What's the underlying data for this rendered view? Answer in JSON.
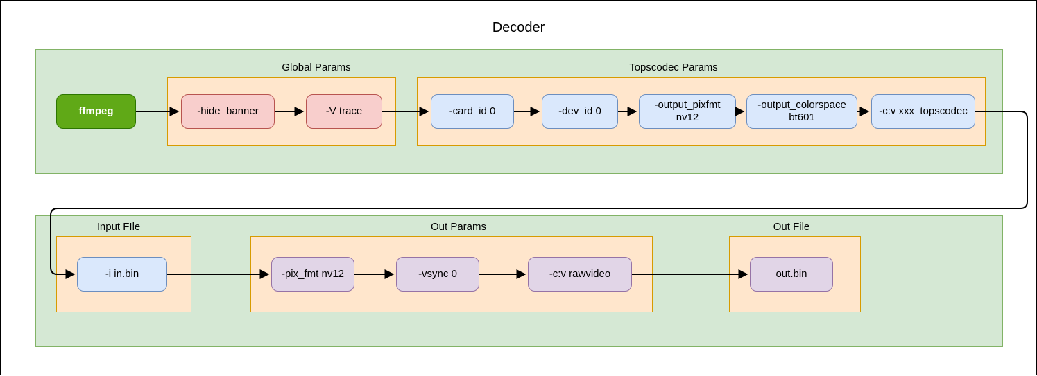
{
  "title": "Decoder",
  "row1": {
    "ffmpeg": "ffmpeg",
    "global_label": "Global Params",
    "global": [
      "-hide_banner",
      "-V trace"
    ],
    "tops_label": "Topscodec  Params",
    "tops": [
      "-card_id 0",
      "-dev_id 0",
      "-output_pixfmt nv12",
      "-output_colorspace bt601",
      "-c:v xxx_topscodec"
    ]
  },
  "row2": {
    "input_label": "Input FIle",
    "input": "-i in.bin",
    "out_params_label": "Out  Params",
    "out_params": [
      "-pix_fmt nv12",
      "-vsync 0",
      "-c:v rawvideo"
    ],
    "out_file_label": "Out File",
    "out_file": "out.bin"
  }
}
